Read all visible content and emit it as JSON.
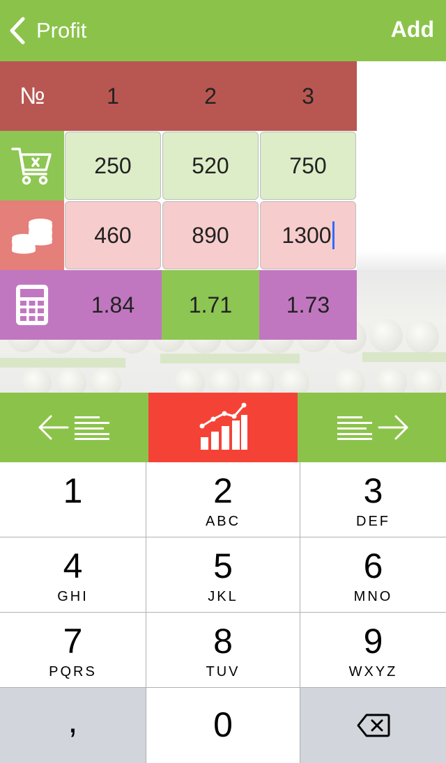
{
  "nav": {
    "back_label": "Profit",
    "add_label": "Add",
    "bar_color": "#8bc34a"
  },
  "table": {
    "header": {
      "symbol": "№",
      "columns": [
        "1",
        "2",
        "3"
      ],
      "color": "#b85752"
    },
    "rows": [
      {
        "name": "purchase",
        "icon": "shopping-cart-icon",
        "values": [
          "250",
          "520",
          "750"
        ]
      },
      {
        "name": "sale",
        "icon": "coin-stack-icon",
        "values": [
          "460",
          "890",
          "1300"
        ]
      },
      {
        "name": "ratio",
        "icon": "calculator-icon",
        "values": [
          "1.84",
          "1.71",
          "1.73"
        ]
      }
    ]
  },
  "toolbar": {
    "left_icon": "arrow-left-lines-icon",
    "middle_icon": "bar-chart-trend-icon",
    "right_icon": "lines-arrow-right-icon"
  },
  "keypad": {
    "keys": [
      {
        "digit": "1",
        "letters": ""
      },
      {
        "digit": "2",
        "letters": "ABC"
      },
      {
        "digit": "3",
        "letters": "DEF"
      },
      {
        "digit": "4",
        "letters": "GHI"
      },
      {
        "digit": "5",
        "letters": "JKL"
      },
      {
        "digit": "6",
        "letters": "MNO"
      },
      {
        "digit": "7",
        "letters": "PQRS"
      },
      {
        "digit": "8",
        "letters": "TUV"
      },
      {
        "digit": "9",
        "letters": "WXYZ"
      },
      {
        "digit": ",",
        "letters": ""
      },
      {
        "digit": "0",
        "letters": ""
      }
    ],
    "delete_icon": "backspace-icon"
  }
}
